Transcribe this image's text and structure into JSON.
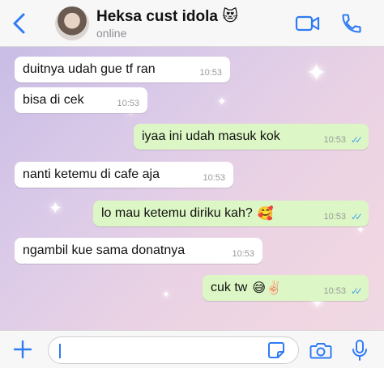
{
  "header": {
    "contact_name": "Heksa cust idola 😻",
    "status": "online"
  },
  "messages": [
    {
      "text": "duitnya udah gue tf ran",
      "time": "10:53",
      "direction": "incoming"
    },
    {
      "text": "bisa di cek",
      "time": "10:53",
      "direction": "incoming"
    },
    {
      "text": "iyaa ini udah masuk kok",
      "time": "10:53",
      "direction": "outgoing",
      "read": true
    },
    {
      "text": "nanti ketemu di cafe aja",
      "time": "10:53",
      "direction": "incoming"
    },
    {
      "text": "lo mau ketemu diriku kah?",
      "emoji": "🥰",
      "time": "10:53",
      "direction": "outgoing",
      "read": true
    },
    {
      "text": "ngambil kue sama donatnya",
      "time": "10:53",
      "direction": "incoming"
    },
    {
      "text": "cuk tw",
      "emoji": "😅✌🏻",
      "time": "10:53",
      "direction": "outgoing",
      "read": true
    }
  ],
  "input": {
    "placeholder": "",
    "value": ""
  },
  "icons": {
    "back": "chevron-left-icon",
    "video": "video-camera-icon",
    "call": "phone-icon",
    "add": "plus-icon",
    "sticker": "sticker-icon",
    "camera": "camera-icon",
    "mic": "microphone-icon"
  },
  "colors": {
    "accent": "#2f7bf6",
    "outgoing_bubble": "#dcf7c5",
    "incoming_bubble": "#ffffff",
    "read_ticks": "#4fa5e6"
  }
}
